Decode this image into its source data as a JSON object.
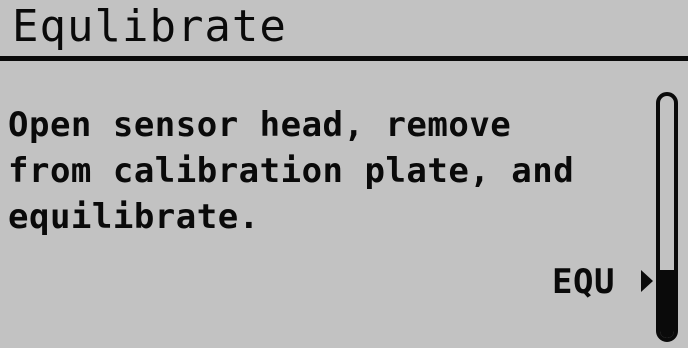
{
  "screen": {
    "title": "Equlibrate",
    "message_lines": [
      "Open sensor head, remove",
      "from calibration plate, and",
      "equilibrate."
    ],
    "mode_label": "EQU",
    "mode_indicator_icon": "right-triangle-arrow-icon",
    "level_meter_fraction": 0.28
  },
  "colors": {
    "background": "#c2c2c2",
    "foreground": "#0a0a0a"
  }
}
